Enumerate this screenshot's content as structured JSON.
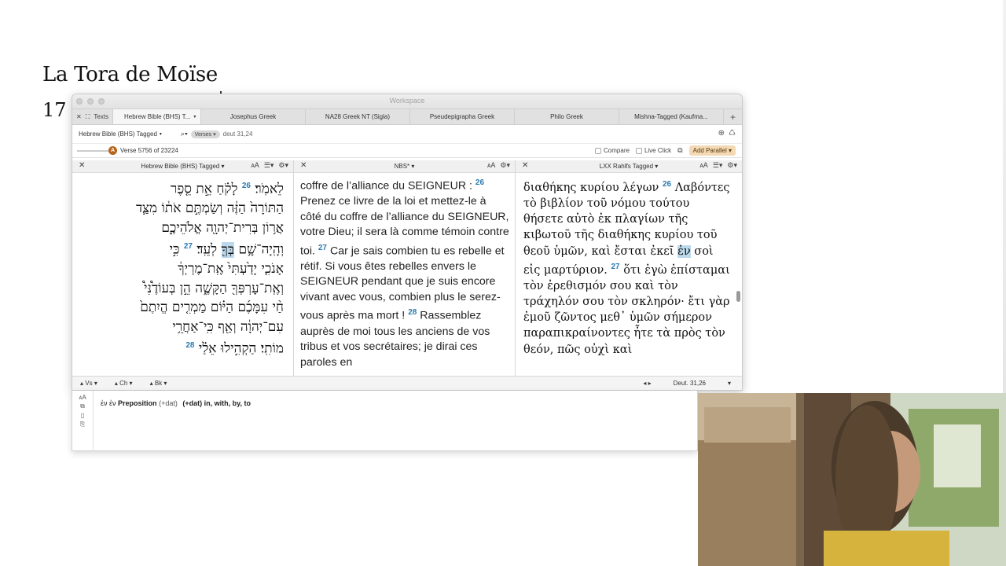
{
  "slide": {
    "title": "La Tora de Moïse",
    "subtitle": "17"
  },
  "window": {
    "title": "Workspace"
  },
  "tabbar": {
    "group_label": "Texts",
    "tabs": [
      {
        "label": "Hebrew Bible (BHS) T..."
      },
      {
        "label": "Josephus Greek"
      },
      {
        "label": "NA28 Greek NT (Sigla)"
      },
      {
        "label": "Pseudepigrapha Greek"
      },
      {
        "label": "Philo Greek"
      },
      {
        "label": "Mishna-Tagged (Kaufma..."
      }
    ],
    "add_label": "+"
  },
  "toolbar": {
    "resource": "Hebrew Bible (BHS) Tagged",
    "search_mode": "Verses",
    "reference": "deut 31,24",
    "verse_badge": "A",
    "verse_info": "Verse 5756 of 23224",
    "compare_label": "Compare",
    "live_click_label": "Live Click",
    "add_parallel_label": "Add Parallel"
  },
  "panes": {
    "hebrew": {
      "header": "Hebrew Bible (BHS) Tagged",
      "lines": [
        {
          "text": "לֵאמֹֽר׃",
          "vnum": "26",
          "text2": "לָקֹ֗חַ אֵ֣ת סֵ֤פֶר"
        },
        {
          "text": "הַתּוֹרָה֙ הַזֶּ֔ה וְשַׂמְתֶּ֣ם אֹת֔וֹ מִצַּ֛ד"
        },
        {
          "text": "אֲר֥וֹן בְּרִית־יְהוָ֖ה אֱלֹהֵיכֶ֑ם"
        },
        {
          "text": "וְהָֽיָה־שָׁ֥ם",
          "hl": "בְּךָ֖",
          "text2": "לְעֵֽד׃",
          "vnum": "27",
          "text3": "כִּ֣י"
        },
        {
          "text": "אָנֹכִ֤י יָדַ֙עְתִּי֙ אֶֽת־מֶרְיְךָ֔"
        },
        {
          "text": "וְאֶֽת־עָרְפְּךָ֖ הַקָּשֶׁ֑ה הֵ֣ן בְּעוֹדֶ֩נִּי֩"
        },
        {
          "text": "חַ֨י עִמָּכֶ֜ם הַיּ֗וֹם מַמְרִ֤ים הֱיִתֶם֙"
        },
        {
          "text": "עִם־יְהוָ֔ה וְאַ֖ף כִּֽי־אַחֲרֵ֥י"
        },
        {
          "text": "מוֹתִֽי׃",
          "vnum": "28",
          "text2": "הַקְהִ֣ילוּ אֵלַ֗י"
        }
      ]
    },
    "french": {
      "header": "NBS*",
      "segments": [
        {
          "text": "coffre de l’alliance du SEIGNEUR : "
        },
        {
          "vnum": "26"
        },
        {
          "text": " Prenez ce livre de la loi et mettez-le à côté du coffre de l’alliance du SEIGNEUR, votre Dieu; il sera là comme témoin contre toi. "
        },
        {
          "vnum": "27"
        },
        {
          "text": " Car je sais combien tu es rebelle et rétif. Si vous êtes rebelles envers le SEIGNEUR pendant que je suis encore vivant avec vous, combien plus le serez-vous après ma mort ! "
        },
        {
          "vnum": "28"
        },
        {
          "text": " Rassemblez auprès de moi tous les anciens de vos tribus et vos secrétaires; je dirai ces paroles en"
        }
      ]
    },
    "greek": {
      "header": "LXX Rahlfs Tagged",
      "segments": [
        {
          "text": "διαθήκης κυρίου λέγων "
        },
        {
          "vnum": "26"
        },
        {
          "text": " Λαβόντες τὸ βιβλίον τοῦ νόμου τούτου θήσετε αὐτὸ ἐκ πλαγίων τῆς κιβωτοῦ τῆς διαθήκης κυρίου τοῦ θεοῦ ὑμῶν, καὶ ἔσται ἐκεῖ "
        },
        {
          "hl": "ἐν"
        },
        {
          "text": " σοὶ εἰς μαρτύριον.  "
        },
        {
          "vnum": "27"
        },
        {
          "text": " ὅτι ἐγὼ ἐπίσταμαι τὸν ἐρεθισμόν σου καὶ τὸν τράχηλόν σου τὸν σκληρόν· ἔτι γὰρ ἐμοῦ ζῶντος μεθ᾽ ὑμῶν σήμερον παραπικραίνοντες ἦτε τὰ πρὸς τὸν θεόν, πῶς οὐχὶ καὶ"
        }
      ]
    }
  },
  "status_bar": {
    "vs": "Vs",
    "ch": "Ch",
    "bk": "Bk",
    "location": "Deut. 31,26"
  },
  "info": {
    "lemma": "ἐν ἐν",
    "pos": "Preposition",
    "case": "(+dat)",
    "gloss": "(+dat) in, with, by, to"
  },
  "colors": {
    "verse_number": "#2a7ab0",
    "highlight": "#bcd9ec",
    "add_parallel_bg": "#f3d9b4",
    "verse_badge": "#b5651d"
  }
}
